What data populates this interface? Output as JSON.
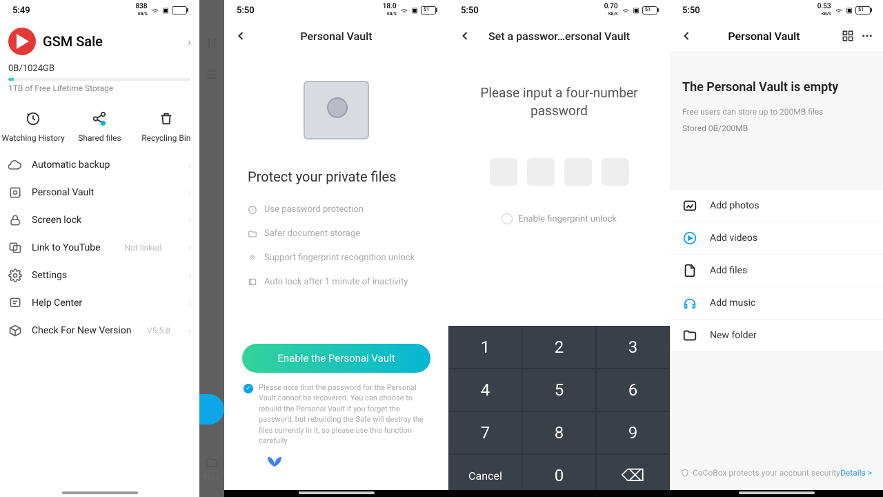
{
  "p1": {
    "time": "5:49",
    "net": "838",
    "netUnit": "KB/S",
    "brand": "GSM Sale",
    "storage": "0B/1024GB",
    "storageSub": "1TB of Free Lifetime Storage",
    "actions": [
      "Watching History",
      "Shared files",
      "Recycling Bin"
    ],
    "menu": {
      "backup": "Automatic backup",
      "vault": "Personal Vault",
      "lock": "Screen lock",
      "youtube": "Link to YouTube",
      "youtubeMeta": "Not linked",
      "settings": "Settings",
      "help": "Help Center",
      "version": "Check For New Version",
      "versionMeta": "V5.5.8"
    }
  },
  "p2": {
    "filesLabel": "Files"
  },
  "p3": {
    "time": "5:50",
    "net": "18.0",
    "netUnit": "KB/S",
    "battery": "51",
    "title": "Personal Vault",
    "heading": "Protect your private files",
    "features": [
      "Use password protection",
      "Safer document storage",
      "Support fingerprint recognition unlock",
      "Auto lock after 1 minute of inactivity"
    ],
    "enable": "Enable the Personal Vault",
    "note": "Please note that the password for the Personal Vault cannot be recovered. You can choose to rebuild the Personal Vault if you forget the password, but rebuilding the Safe will destroy the files currently in it, so please use this function carefully"
  },
  "p4": {
    "time": "5:50",
    "net": "0.70",
    "netUnit": "KB/S",
    "battery": "51",
    "title": "Set a passwor…ersonal Vault",
    "prompt": "Please input a four-number password",
    "fingerprint": "Enable fingerprint unlock",
    "keys": [
      "1",
      "2",
      "3",
      "4",
      "5",
      "6",
      "7",
      "8",
      "9",
      "Cancel",
      "0",
      "⌫"
    ]
  },
  "p5": {
    "time": "5:50",
    "net": "0.53",
    "netUnit": "KB/S",
    "battery": "51",
    "title": "Personal Vault",
    "empty": "The Personal Vault is empty",
    "sub": "Free users can store up to 200MB files",
    "stored": "Stored 0B/200MB",
    "add": [
      "Add photos",
      "Add videos",
      "Add files",
      "Add music",
      "New folder"
    ],
    "security": "CoCoBox protects your account security",
    "details": "Details >"
  }
}
